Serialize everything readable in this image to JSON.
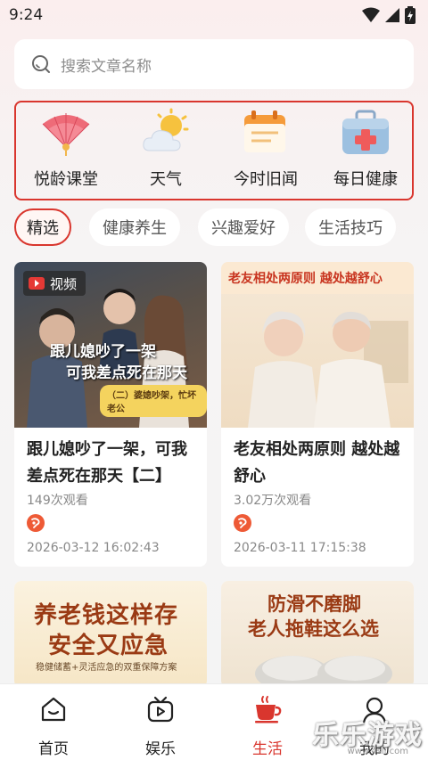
{
  "status_bar": {
    "time": "9:24"
  },
  "search": {
    "placeholder": "搜索文章名称"
  },
  "quick_entries": [
    {
      "label": "悦龄课堂",
      "icon": "fan-icon"
    },
    {
      "label": "天气",
      "icon": "weather-icon"
    },
    {
      "label": "今时旧闻",
      "icon": "calendar-icon"
    },
    {
      "label": "每日健康",
      "icon": "medical-kit-icon"
    }
  ],
  "tabs": [
    {
      "label": "精选",
      "active": true
    },
    {
      "label": "健康养生",
      "active": false
    },
    {
      "label": "兴趣爱好",
      "active": false
    },
    {
      "label": "生活技巧",
      "active": false
    }
  ],
  "cards": [
    {
      "badge": "视频",
      "overlay_title_1": "跟儿媳吵了一架",
      "overlay_title_2": "可我差点死在那天",
      "overlay_caption": "（二）婆媳吵架，忙坏老公",
      "title": "跟儿媳吵了一架，可我差点死在那天【二】",
      "views": "149次观看",
      "time": "2026-03-12 16:02:43"
    },
    {
      "overlay_title": "老友相处两原则 越处越舒心",
      "title": "老友相处两原则 越处越舒心",
      "views": "3.02万次观看",
      "time": "2026-03-11 17:15:38"
    },
    {
      "overlay_title_1": "养老钱这样存",
      "overlay_title_2": "安全又应急",
      "overlay_caption": "稳健储蓄+灵活应急的双重保障方案"
    },
    {
      "overlay_title_1": "防滑不磨脚",
      "overlay_title_2": "老人拖鞋这么选"
    }
  ],
  "bottom_nav": [
    {
      "label": "首页",
      "active": false
    },
    {
      "label": "娱乐",
      "active": false
    },
    {
      "label": "生活",
      "active": true
    },
    {
      "label": "我的",
      "active": false
    }
  ],
  "watermark": {
    "text": "乐乐游戏",
    "url": "www.4sll.com"
  },
  "colors": {
    "accent": "#d9362e",
    "background": "#f4f4f4"
  }
}
